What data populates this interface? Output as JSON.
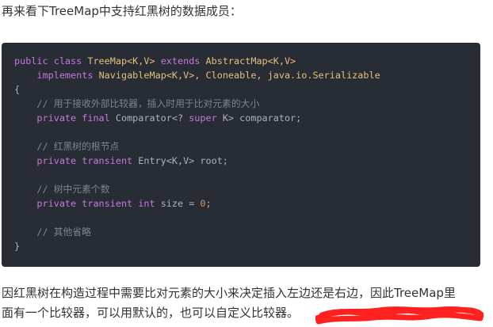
{
  "intro_text": "再来看下TreeMap中支持红黑树的数据成员：",
  "code": {
    "lines": [
      [
        {
          "t": "public class ",
          "c": "kw"
        },
        {
          "t": "TreeMap<K,V> ",
          "c": "ty"
        },
        {
          "t": "extends ",
          "c": "kw"
        },
        {
          "t": "AbstractMap<K,V>",
          "c": "ty"
        }
      ],
      [
        {
          "t": "    ",
          "c": "pl"
        },
        {
          "t": "implements ",
          "c": "kw"
        },
        {
          "t": "NavigableMap<K,V>, Cloneable, java.io.Serializable",
          "c": "ty"
        }
      ],
      [
        {
          "t": "{",
          "c": "pl"
        }
      ],
      [
        {
          "t": "    // 用于接收外部比较器，插入时用于比对元素的大小",
          "c": "cm"
        }
      ],
      [
        {
          "t": "    ",
          "c": "pl"
        },
        {
          "t": "private final ",
          "c": "kw"
        },
        {
          "t": "Comparator<? ",
          "c": "pl"
        },
        {
          "t": "super ",
          "c": "kw"
        },
        {
          "t": "K> comparator;",
          "c": "pl"
        }
      ],
      [],
      [
        {
          "t": "    // 红黑树的根节点",
          "c": "cm"
        }
      ],
      [
        {
          "t": "    ",
          "c": "pl"
        },
        {
          "t": "private transient ",
          "c": "kw"
        },
        {
          "t": "Entry<K,V> root;",
          "c": "pl"
        }
      ],
      [],
      [
        {
          "t": "    // 树中元素个数",
          "c": "cm"
        }
      ],
      [
        {
          "t": "    ",
          "c": "pl"
        },
        {
          "t": "private transient ",
          "c": "kw"
        },
        {
          "t": "int ",
          "c": "kw"
        },
        {
          "t": "size = ",
          "c": "pl"
        },
        {
          "t": "0",
          "c": "nm"
        },
        {
          "t": ";",
          "c": "pl"
        }
      ],
      [],
      [
        {
          "t": "    // 其他省略",
          "c": "cm"
        }
      ],
      [
        {
          "t": "}",
          "c": "pl"
        }
      ]
    ]
  },
  "paragraph": {
    "line1": "因红黑树在构造过程中需要比对元素的大小来决定插入左边还是右边，因此TreeMap里",
    "line2": "面有一个比较器，可以用默认的，也可以自定义比较器。"
  },
  "redaction_color": "#ff2020"
}
